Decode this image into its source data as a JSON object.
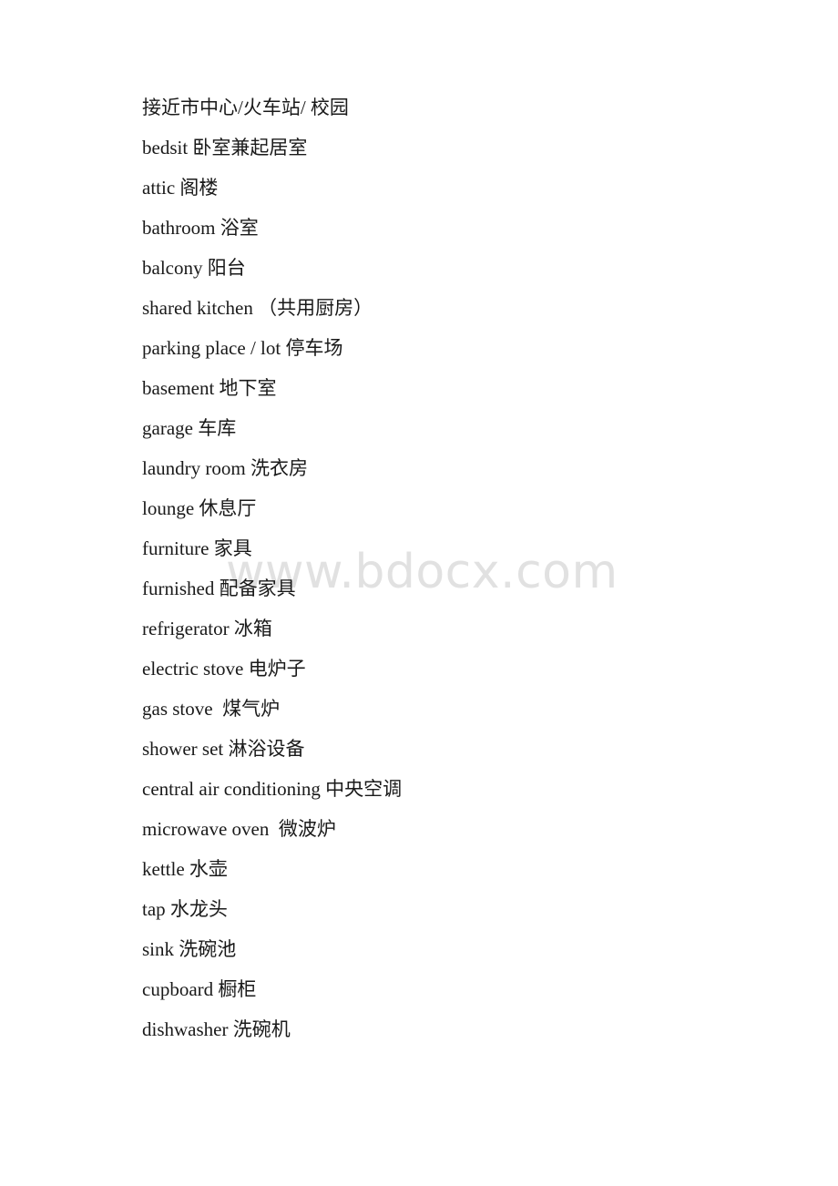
{
  "document": {
    "page_background": "#ffffff",
    "text_color": "#1a1a1a",
    "lines": [
      {
        "id": "line-1",
        "text": "接近市中心/火车站/ 校园"
      },
      {
        "id": "line-2",
        "text": "bedsit 卧室兼起居室"
      },
      {
        "id": "line-3",
        "text": "attic 阁楼"
      },
      {
        "id": "line-4",
        "text": "bathroom 浴室"
      },
      {
        "id": "line-5",
        "text": "balcony 阳台"
      },
      {
        "id": "line-6",
        "text": "shared kitchen （共用厨房）"
      },
      {
        "id": "line-7",
        "text": "parking place / lot 停车场"
      },
      {
        "id": "line-8",
        "text": "basement 地下室"
      },
      {
        "id": "line-9",
        "text": "garage 车库"
      },
      {
        "id": "line-10",
        "text": "laundry room 洗衣房"
      },
      {
        "id": "line-11",
        "text": "lounge 休息厅"
      },
      {
        "id": "line-12",
        "text": "furniture 家具"
      },
      {
        "id": "line-13",
        "text": "furnished 配备家具"
      },
      {
        "id": "line-14",
        "text": "refrigerator 冰箱"
      },
      {
        "id": "line-15",
        "text": "electric stove 电炉子"
      },
      {
        "id": "line-16",
        "text": "gas stove  煤气炉"
      },
      {
        "id": "line-17",
        "text": "shower set 淋浴设备"
      },
      {
        "id": "line-18",
        "text": "central air conditioning 中央空调"
      },
      {
        "id": "line-19",
        "text": "microwave oven  微波炉"
      },
      {
        "id": "line-20",
        "text": "kettle 水壶"
      },
      {
        "id": "line-21",
        "text": "tap 水龙头"
      },
      {
        "id": "line-22",
        "text": "sink 洗碗池"
      },
      {
        "id": "line-23",
        "text": "cupboard 橱柜"
      },
      {
        "id": "line-24",
        "text": "dishwasher 洗碗机"
      }
    ]
  },
  "watermark": {
    "text": "www.bdocx.com",
    "color": "#e1e1e1"
  }
}
